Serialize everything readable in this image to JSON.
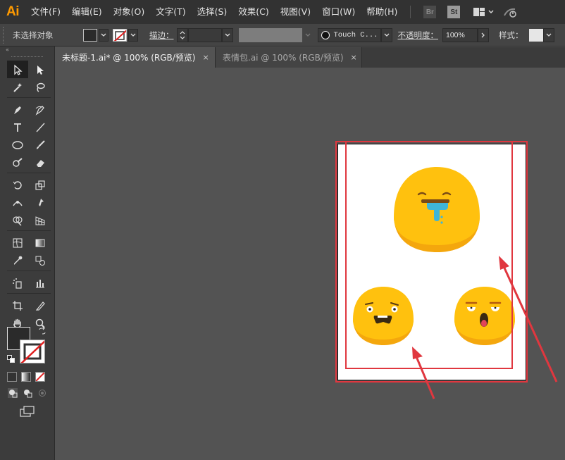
{
  "app": {
    "logo": "Ai"
  },
  "menu": {
    "items": [
      "文件(F)",
      "编辑(E)",
      "对象(O)",
      "文字(T)",
      "选择(S)",
      "效果(C)",
      "视图(V)",
      "窗口(W)",
      "帮助(H)"
    ],
    "bridge_badge": "Br",
    "stock_badge": "St",
    "workspace_icon": "workspace-switcher-icon",
    "gpu_icon": "gpu-performance-icon"
  },
  "control": {
    "selection_status": "未选择对象",
    "fill_color": "#2b2b2b",
    "stroke_label": "描边：",
    "brush_name": "Touch C...",
    "opacity_label": "不透明度：",
    "opacity_value": "100%",
    "style_label": "样式："
  },
  "tabs": [
    {
      "label": "未标题-1.ai* @ 100% (RGB/预览)",
      "close": "×",
      "active": true
    },
    {
      "label": "表情包.ai @ 100% (RGB/预览)",
      "close": "×",
      "active": false
    }
  ],
  "toolbox": {
    "collapse": "«",
    "tools": [
      "selection-tool-icon",
      "direct-selection-tool-icon",
      "magic-wand-tool-icon",
      "lasso-tool-icon",
      "pen-tool-icon",
      "curvature-tool-icon",
      "type-tool-icon",
      "line-segment-tool-icon",
      "ellipse-tool-icon",
      "paintbrush-tool-icon",
      "shaper-tool-icon",
      "eraser-tool-icon",
      "rotate-tool-icon",
      "scale-tool-icon",
      "width-tool-icon",
      "puppet-warp-tool-icon",
      "shape-builder-tool-icon",
      "perspective-grid-tool-icon",
      "mesh-tool-icon",
      "gradient-tool-icon",
      "eyedropper-tool-icon",
      "blend-tool-icon",
      "symbol-sprayer-tool-icon",
      "column-graph-tool-icon",
      "artboard-tool-icon",
      "slice-tool-icon",
      "hand-tool-icon",
      "zoom-tool-icon"
    ]
  },
  "colors": {
    "accent": "#ff9a00",
    "highlight_red": "#e0373f",
    "emoji_top": "#ffc10e",
    "emoji_bottom": "#f4a70d",
    "drool": "#3fb5d8"
  }
}
